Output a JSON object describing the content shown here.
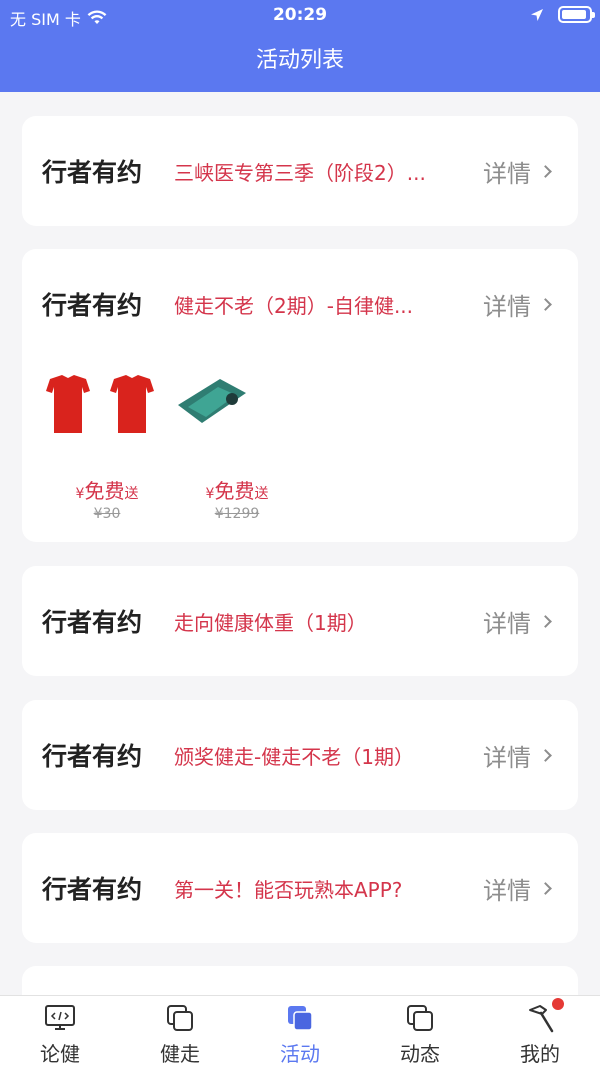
{
  "status_bar": {
    "carrier": "无 SIM 卡",
    "time": "20:29"
  },
  "header": {
    "title": "活动列表"
  },
  "activities": [
    {
      "brand": "行者有约",
      "title": "三峡医专第三季（阶段2）...",
      "detail": "详情"
    },
    {
      "brand": "行者有约",
      "title": "健走不老（2期）-自律健...",
      "detail": "详情",
      "prizes": [
        {
          "name": "t-shirt-prize",
          "yen": "¥",
          "price": "免费",
          "suffix": "送",
          "original": "¥30"
        },
        {
          "name": "phone-prize",
          "yen": "¥",
          "price": "免费",
          "suffix": "送",
          "original": "¥1299"
        }
      ]
    },
    {
      "brand": "行者有约",
      "title": "走向健康体重（1期）",
      "detail": "详情"
    },
    {
      "brand": "行者有约",
      "title": "颁奖健走-健走不老（1期）",
      "detail": "详情"
    },
    {
      "brand": "行者有约",
      "title": "第一关！能否玩熟本APP?",
      "detail": "详情"
    }
  ],
  "tabbar": {
    "items": [
      {
        "label": "论健",
        "icon": "monitor-code-icon"
      },
      {
        "label": "健走",
        "icon": "stacked-squares-icon"
      },
      {
        "label": "活动",
        "icon": "stacked-squares-filled-icon",
        "active": true
      },
      {
        "label": "动态",
        "icon": "stacked-squares-icon"
      },
      {
        "label": "我的",
        "icon": "hammer-icon",
        "badge": true
      }
    ]
  },
  "colors": {
    "primary": "#5b78f0",
    "accent_red": "#d4354b",
    "background": "#f5f5f7"
  }
}
